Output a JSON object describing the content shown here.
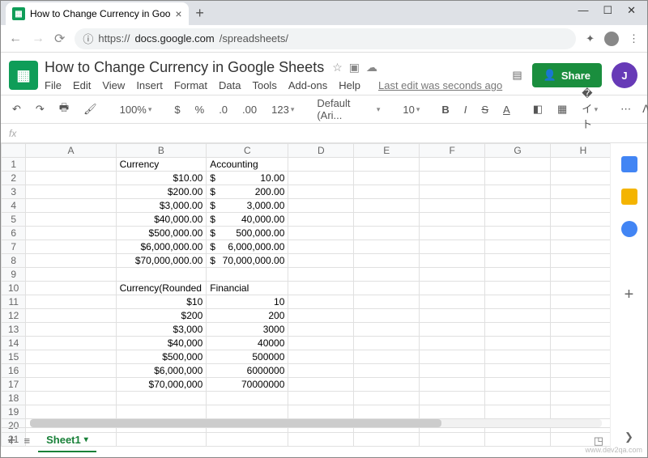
{
  "browser": {
    "tab_title": "How to Change Currency in Goo",
    "url_prefix": "https://",
    "url_host": "docs.google.com",
    "url_path": "/spreadsheets/"
  },
  "doc": {
    "title": "How to Change Currency in Google Sheets",
    "last_edit": "Last edit was seconds ago",
    "menus": [
      "File",
      "Edit",
      "View",
      "Insert",
      "Format",
      "Data",
      "Tools",
      "Add-ons",
      "Help"
    ],
    "share_label": "Share",
    "avatar_letter": "J"
  },
  "toolbar": {
    "zoom": "100%",
    "currency": "$",
    "percent": "%",
    "dec_dec": ".0",
    "dec_inc": ".00",
    "more_fmt": "123",
    "font": "Default (Ari...",
    "size": "10",
    "bold": "B",
    "italic": "I",
    "strike": "S",
    "textcolor": "A"
  },
  "fx_label": "fx",
  "columns": [
    "A",
    "B",
    "C",
    "D",
    "E",
    "F",
    "G",
    "H"
  ],
  "rows": [
    {
      "n": 1,
      "B": "Currency",
      "C": "Accounting",
      "Bleft": true,
      "Cleft": true
    },
    {
      "n": 2,
      "B": "$10.00",
      "Cs": "$",
      "Cv": "10.00"
    },
    {
      "n": 3,
      "B": "$200.00",
      "Cs": "$",
      "Cv": "200.00"
    },
    {
      "n": 4,
      "B": "$3,000.00",
      "Cs": "$",
      "Cv": "3,000.00"
    },
    {
      "n": 5,
      "B": "$40,000.00",
      "Cs": "$",
      "Cv": "40,000.00"
    },
    {
      "n": 6,
      "B": "$500,000.00",
      "Cs": "$",
      "Cv": "500,000.00"
    },
    {
      "n": 7,
      "B": "$6,000,000.00",
      "Cs": "$",
      "Cv": "6,000,000.00"
    },
    {
      "n": 8,
      "B": "$70,000,000.00",
      "Cs": "$",
      "Cv": "70,000,000.00"
    },
    {
      "n": 9
    },
    {
      "n": 10,
      "B": "Currency(Rounded",
      "C": "Financial",
      "Bleft": true,
      "Cleft": true
    },
    {
      "n": 11,
      "B": "$10",
      "Cv": "10"
    },
    {
      "n": 12,
      "B": "$200",
      "Cv": "200"
    },
    {
      "n": 13,
      "B": "$3,000",
      "Cv": "3000"
    },
    {
      "n": 14,
      "B": "$40,000",
      "Cv": "40000"
    },
    {
      "n": 15,
      "B": "$500,000",
      "Cv": "500000"
    },
    {
      "n": 16,
      "B": "$6,000,000",
      "Cv": "6000000"
    },
    {
      "n": 17,
      "B": "$70,000,000",
      "Cv": "70000000"
    },
    {
      "n": 18
    },
    {
      "n": 19
    },
    {
      "n": 20
    },
    {
      "n": 21
    }
  ],
  "sheet_tab": "Sheet1",
  "watermark": "www.dev2qa.com",
  "side_colors": [
    "#f4b400",
    "#4285f4",
    "#ea4335"
  ],
  "chart_data": {
    "type": "table",
    "title": "How to Change Currency in Google Sheets",
    "columns": [
      "Currency",
      "Accounting",
      "Currency(Rounded",
      "Financial"
    ],
    "currency": [
      "$10.00",
      "$200.00",
      "$3,000.00",
      "$40,000.00",
      "$500,000.00",
      "$6,000,000.00",
      "$70,000,000.00"
    ],
    "accounting": [
      10.0,
      200.0,
      3000.0,
      40000.0,
      500000.0,
      6000000.0,
      70000000.0
    ],
    "currency_rounded": [
      "$10",
      "$200",
      "$3,000",
      "$40,000",
      "$500,000",
      "$6,000,000",
      "$70,000,000"
    ],
    "financial": [
      10,
      200,
      3000,
      40000,
      500000,
      6000000,
      70000000
    ]
  }
}
